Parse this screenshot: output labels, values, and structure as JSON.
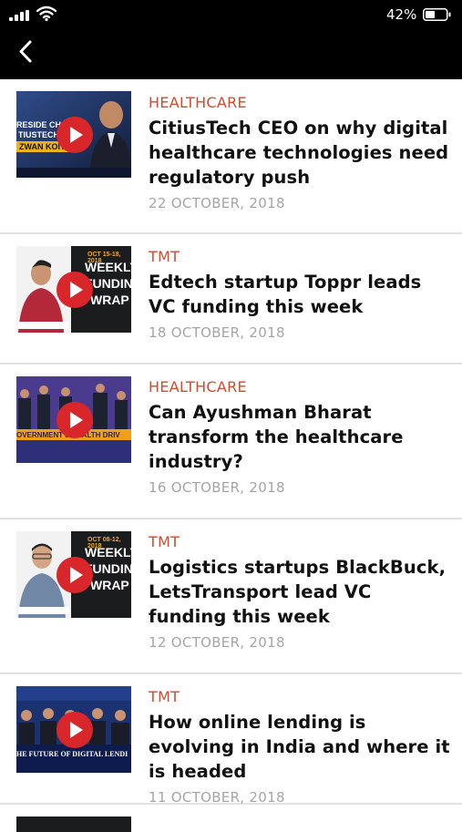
{
  "status_bar": {
    "battery_percent": "42%"
  },
  "articles": [
    {
      "category": "HEALTHCARE",
      "title": "CitiusTech CEO on why digital healthcare technologies need regulatory push",
      "date": "22 OCTOBER, 2018",
      "thumb_text": [
        "RESIDE CHAT",
        "TIUSTECH",
        "ZWAN KOITA"
      ]
    },
    {
      "category": "TMT",
      "title": "Edtech startup Toppr leads VC funding this week",
      "date": "18 OCTOBER, 2018",
      "thumb_text": [
        "OCT 15-18, 2018",
        "WEEKLY",
        "FUNDING",
        "WRAP"
      ]
    },
    {
      "category": "HEALTHCARE",
      "title": "Can Ayushman Bharat transform the healthcare industry?",
      "date": "16 OCTOBER, 2018",
      "thumb_text": [
        "OVERNMENT'S HEALTH DRIV"
      ]
    },
    {
      "category": "TMT",
      "title": "Logistics startups BlackBuck, LetsTransport lead VC funding this week",
      "date": "12 OCTOBER, 2018",
      "thumb_text": [
        "OCT 08-12, 2018",
        "WEEKLY",
        "FUNDING",
        "WRAP"
      ]
    },
    {
      "category": "TMT",
      "title": "How online lending is evolving in India and where it is headed",
      "date": "11 OCTOBER, 2018",
      "thumb_text": [
        "HE FUTURE OF DIGITAL LENDI"
      ]
    }
  ]
}
